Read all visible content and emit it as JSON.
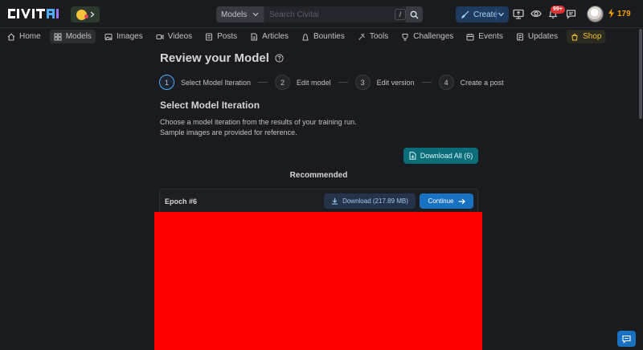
{
  "header": {
    "logo_text": "CIVITAI",
    "search_scope": "Models",
    "search_placeholder": "Search Civitai",
    "search_shortcut": "/",
    "create_label": "Create",
    "notification_count": "99+",
    "buzz_amount": "179"
  },
  "nav": {
    "items": [
      {
        "label": "Home",
        "icon": "home-icon"
      },
      {
        "label": "Models",
        "icon": "models-icon",
        "active": true
      },
      {
        "label": "Images",
        "icon": "images-icon"
      },
      {
        "label": "Videos",
        "icon": "videos-icon"
      },
      {
        "label": "Posts",
        "icon": "posts-icon"
      },
      {
        "label": "Articles",
        "icon": "articles-icon"
      },
      {
        "label": "Bounties",
        "icon": "bounties-icon"
      },
      {
        "label": "Tools",
        "icon": "tools-icon"
      },
      {
        "label": "Challenges",
        "icon": "challenges-icon"
      },
      {
        "label": "Events",
        "icon": "events-icon"
      },
      {
        "label": "Updates",
        "icon": "updates-icon"
      },
      {
        "label": "Shop",
        "icon": "shop-icon"
      }
    ]
  },
  "page": {
    "title": "Review your Model",
    "steps": [
      {
        "number": "1",
        "label": "Select Model Iteration",
        "active": true
      },
      {
        "number": "2",
        "label": "Edit model"
      },
      {
        "number": "3",
        "label": "Edit version"
      },
      {
        "number": "4",
        "label": "Create a post"
      }
    ],
    "section_title": "Select Model Iteration",
    "description_line1": "Choose a model iteration from the results of your training run.",
    "description_line2": "Sample images are provided for reference.",
    "download_all_label": "Download All (6)",
    "recommended_label": "Recommended",
    "epoch": {
      "label": "Epoch #6",
      "download_label": "Download (217.89 MB)",
      "continue_label": "Continue"
    }
  },
  "colors": {
    "background": "#1a1b1e",
    "accent_blue": "#1971c2",
    "teal": "#0c6d7a",
    "preview": "#ff0000",
    "buzz": "#f59f00"
  }
}
